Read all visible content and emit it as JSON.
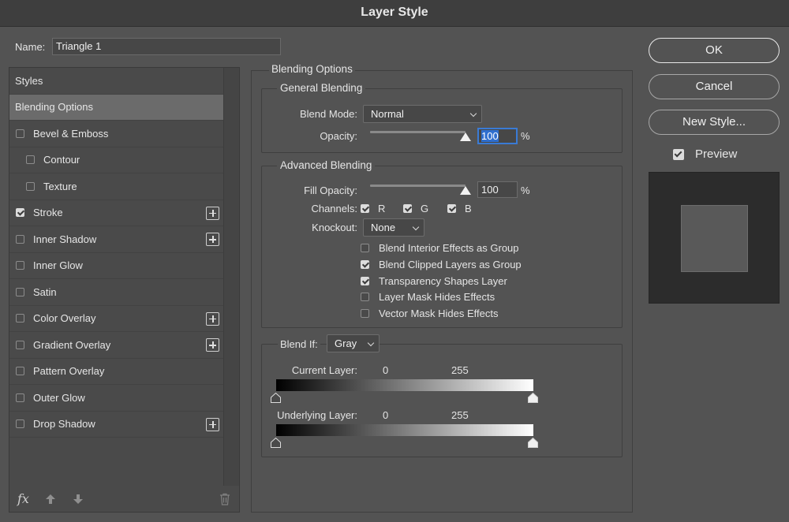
{
  "window": {
    "title": "Layer Style"
  },
  "name_field": {
    "label": "Name:",
    "value": "Triangle 1"
  },
  "styles_panel": {
    "header": "Styles",
    "selected": "Blending Options",
    "items": [
      {
        "label": "Bevel & Emboss",
        "checked": false,
        "indent": false,
        "plus": false
      },
      {
        "label": "Contour",
        "checked": false,
        "indent": true,
        "plus": false
      },
      {
        "label": "Texture",
        "checked": false,
        "indent": true,
        "plus": false
      },
      {
        "label": "Stroke",
        "checked": true,
        "indent": false,
        "plus": true
      },
      {
        "label": "Inner Shadow",
        "checked": false,
        "indent": false,
        "plus": true
      },
      {
        "label": "Inner Glow",
        "checked": false,
        "indent": false,
        "plus": false
      },
      {
        "label": "Satin",
        "checked": false,
        "indent": false,
        "plus": false
      },
      {
        "label": "Color Overlay",
        "checked": false,
        "indent": false,
        "plus": true
      },
      {
        "label": "Gradient Overlay",
        "checked": false,
        "indent": false,
        "plus": true
      },
      {
        "label": "Pattern Overlay",
        "checked": false,
        "indent": false,
        "plus": false
      },
      {
        "label": "Outer Glow",
        "checked": false,
        "indent": false,
        "plus": false
      },
      {
        "label": "Drop Shadow",
        "checked": false,
        "indent": false,
        "plus": true
      }
    ],
    "footer": {
      "fx_label": "fx"
    }
  },
  "blending": {
    "title": "Blending Options",
    "general": {
      "title": "General Blending",
      "blend_mode_label": "Blend Mode:",
      "blend_mode_value": "Normal",
      "opacity_label": "Opacity:",
      "opacity_value": "100",
      "opacity_fraction": 1.0,
      "unit": "%"
    },
    "advanced": {
      "title": "Advanced Blending",
      "fill_opacity_label": "Fill Opacity:",
      "fill_opacity_value": "100",
      "fill_opacity_fraction": 1.0,
      "unit": "%",
      "channels_label": "Channels:",
      "channels": [
        {
          "label": "R",
          "checked": true
        },
        {
          "label": "G",
          "checked": true
        },
        {
          "label": "B",
          "checked": true
        }
      ],
      "knockout_label": "Knockout:",
      "knockout_value": "None",
      "options": [
        {
          "label": "Blend Interior Effects as Group",
          "checked": false
        },
        {
          "label": "Blend Clipped Layers as Group",
          "checked": true
        },
        {
          "label": "Transparency Shapes Layer",
          "checked": true
        },
        {
          "label": "Layer Mask Hides Effects",
          "checked": false
        },
        {
          "label": "Vector Mask Hides Effects",
          "checked": false
        }
      ]
    },
    "blend_if": {
      "label": "Blend If:",
      "value": "Gray",
      "current_layer": {
        "label": "Current Layer:",
        "low": "0",
        "high": "255"
      },
      "underlying_layer": {
        "label": "Underlying Layer:",
        "low": "0",
        "high": "255"
      }
    }
  },
  "buttons": {
    "ok": "OK",
    "cancel": "Cancel",
    "new_style": "New Style..."
  },
  "preview": {
    "label": "Preview",
    "checked": true
  }
}
